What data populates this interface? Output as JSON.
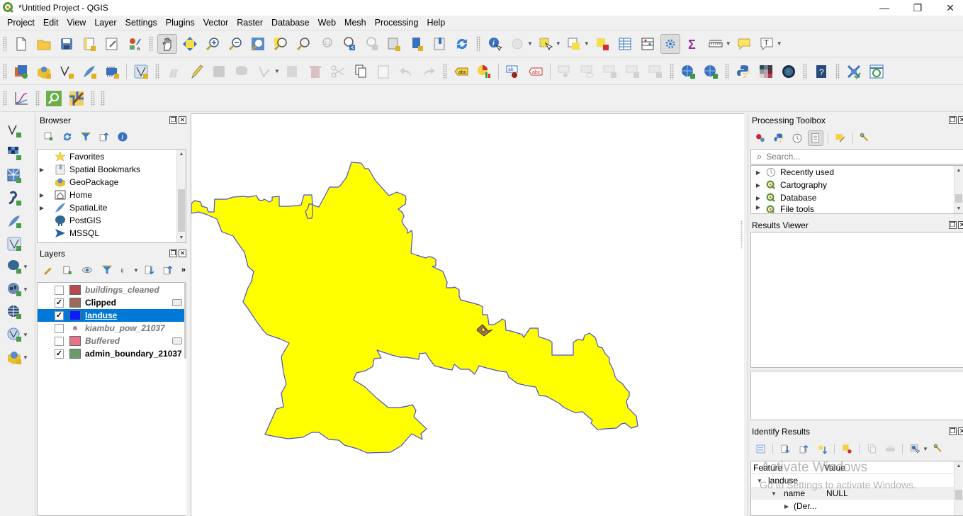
{
  "window": {
    "title": "*Untitled Project - QGIS",
    "controls": {
      "minimize": "—",
      "restore": "❐",
      "close": "✕"
    }
  },
  "menubar": [
    "Project",
    "Edit",
    "View",
    "Layer",
    "Settings",
    "Plugins",
    "Vector",
    "Raster",
    "Database",
    "Web",
    "Mesh",
    "Processing",
    "Help"
  ],
  "toolbars": {
    "row1": [
      "new-project",
      "open-project",
      "save-project",
      "new-print-layout",
      "layout-manager",
      "style-manager",
      "pan-map",
      "pan-to-selection",
      "zoom-in",
      "zoom-out",
      "zoom-full",
      "zoom-to-selection",
      "zoom-to-layer",
      "zoom-native",
      "zoom-last",
      "zoom-next",
      "new-map-view",
      "new-bookmark",
      "show-bookmarks",
      "refresh",
      "identify-features",
      "run-feature-action",
      "select-features",
      "select-by-value",
      "deselect-all",
      "open-attribute-table",
      "field-calculator",
      "processing-toolbox",
      "statistical-summary",
      "measure-line",
      "map-tips",
      "text-annotation"
    ],
    "row2": [
      "data-source-manager",
      "new-geopackage-layer",
      "new-shapefile-layer",
      "new-spatialite-layer",
      "new-temporary-scratch-layer",
      "new-virtual-layer",
      "current-edits",
      "toggle-editing",
      "save-layer-edits",
      "add-polygon-feature",
      "vertex-tool",
      "modify-attributes",
      "delete-selected",
      "cut-features",
      "copy-features",
      "paste-features",
      "undo",
      "redo",
      "layer-labeling-options",
      "layer-diagram-options",
      "label-tool-highlight-pinned",
      "label-tool-pin",
      "label-tool-show-hide",
      "label-tool-move",
      "label-tool-rotate",
      "label-tool-change",
      "label-tool-preview",
      "metasearch",
      "metasearch-search",
      "python-console",
      "raster-layer-stats",
      "globe",
      "qgis-help",
      "georeferencer",
      "table-sync"
    ],
    "row3": [
      "elevation-profile",
      "locator-search",
      "style-dock"
    ]
  },
  "left_vertical_toolbar": [
    "add-vector-layer",
    "add-raster-layer",
    "add-mesh-layer",
    "add-delimited-text-layer",
    "add-spatialite-layer",
    "add-virtual-layer",
    "add-postgis-layer",
    "add-wms-layer",
    "add-xyz-layer",
    "add-wfs-layer",
    "add-geonode-layer"
  ],
  "browser": {
    "title": "Browser",
    "toolbar": [
      "add-selected-layers",
      "refresh",
      "filter-browser",
      "collapse-all",
      "properties"
    ],
    "items": [
      {
        "label": "Favorites",
        "icon": "star-icon",
        "expandable": false
      },
      {
        "label": "Spatial Bookmarks",
        "icon": "bookmark-icon",
        "expandable": true
      },
      {
        "label": "GeoPackage",
        "icon": "geopackage-icon",
        "expandable": false
      },
      {
        "label": "Home",
        "icon": "home-folder-icon",
        "expandable": true
      },
      {
        "label": "SpatiaLite",
        "icon": "feather-icon",
        "expandable": true
      },
      {
        "label": "PostGIS",
        "icon": "elephant-icon",
        "expandable": false
      },
      {
        "label": "MSSQL",
        "icon": "mssql-icon",
        "expandable": false
      }
    ]
  },
  "layers": {
    "title": "Layers",
    "toolbar": [
      "open-layer-styling",
      "add-group",
      "manage-map-themes",
      "filter-legend",
      "filter-by-expression",
      "expand-all",
      "collapse-all",
      "more"
    ],
    "items": [
      {
        "name": "buildings_cleaned",
        "checked": false,
        "color": "#b84a4e",
        "kind": "fill",
        "visible_style": "off",
        "memory": false
      },
      {
        "name": "Clipped",
        "checked": true,
        "color": "#9c6a55",
        "kind": "fill",
        "visible_style": "on",
        "memory": true
      },
      {
        "name": "landuse",
        "checked": true,
        "color": "#0a1cff",
        "kind": "fill",
        "visible_style": "selected",
        "memory": false
      },
      {
        "name": "kiambu_pow_21037",
        "checked": false,
        "color": "#e87c9a",
        "kind": "point",
        "visible_style": "off",
        "memory": false
      },
      {
        "name": "Buffered",
        "checked": false,
        "color": "#e8728a",
        "kind": "fill",
        "visible_style": "off",
        "memory": true
      },
      {
        "name": "admin_boundary_21037",
        "checked": true,
        "color": "#6b9a6e",
        "kind": "fill",
        "visible_style": "on",
        "memory": false
      }
    ]
  },
  "map": {
    "fill_color": "#ffff00",
    "stroke_color": "#4a4fd0",
    "feature_fill": "#a0704f"
  },
  "processing_toolbox": {
    "title": "Processing Toolbox",
    "toolbar": [
      "models",
      "scripts",
      "history",
      "results-viewer",
      "edit-features-in-place",
      "options"
    ],
    "search_placeholder": "Search...",
    "items": [
      {
        "label": "Recently used",
        "icon": "clock-icon"
      },
      {
        "label": "Cartography",
        "icon": "qgis-icon"
      },
      {
        "label": "Database",
        "icon": "qgis-icon"
      },
      {
        "label": "File tools",
        "icon": "qgis-icon"
      }
    ]
  },
  "results_viewer": {
    "title": "Results Viewer"
  },
  "identify_results": {
    "title": "Identify Results",
    "toolbar": [
      "expand-tree",
      "expand-all",
      "collapse-all",
      "expand-new-results",
      "clear-results",
      "copy-feature",
      "print-response",
      "identify-mode",
      "settings"
    ],
    "columns": [
      "Feature",
      "Value"
    ],
    "rows": [
      {
        "feature": "landuse",
        "value": "",
        "level": 0
      },
      {
        "feature": "name",
        "value": "NULL",
        "level": 1
      },
      {
        "feature": "(Der...",
        "value": "",
        "level": 2
      }
    ]
  },
  "watermark": {
    "line1": "Activate Windows",
    "line2": "Go to Settings to activate Windows."
  }
}
